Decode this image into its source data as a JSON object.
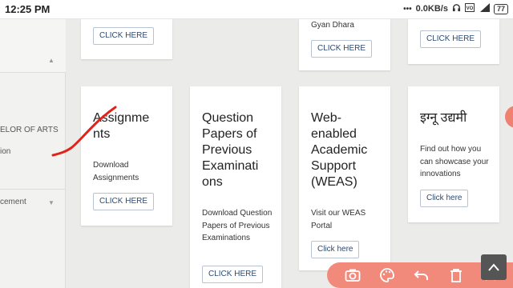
{
  "status_bar": {
    "time": "12:25 PM",
    "network_speed": "0.0KB/s",
    "battery": "77",
    "icons": [
      "dots-icon",
      "headphones-icon",
      "volte-icon",
      "signal-4g-icon",
      "battery-icon"
    ]
  },
  "sidebar": {
    "items": [
      {
        "label": "ELOR OF ARTS"
      },
      {
        "label": "ion"
      },
      {
        "label": "cement"
      }
    ]
  },
  "top_cards": [
    {
      "button": "CLICK HERE"
    },
    {
      "title": "Gyan Dhara",
      "button": "CLICK HERE"
    },
    {
      "button": "CLICK HERE"
    }
  ],
  "cards": [
    {
      "title": "Assignme nts",
      "desc": "Download Assignments",
      "button": "CLICK HERE"
    },
    {
      "title": "Question Papers of Previous Examinati ons",
      "desc": "Download Question Papers of Previous Examinations",
      "button": "CLICK HERE"
    },
    {
      "title": "Web- enabled Academic Support (WEAS)",
      "desc": "Visit our WEAS Portal",
      "button": "Click here"
    },
    {
      "title": "इग्नू उद्यमी",
      "desc": "Find out how you can showcase your innovations",
      "button": "Click here"
    }
  ],
  "colors": {
    "accent_toolbar": "#f18a7b",
    "button_text": "#2c4a73",
    "annotation_stroke": "#e0241b",
    "page_bg": "#ebebe9"
  },
  "toolbar": {
    "icons": [
      "camera-icon",
      "palette-icon",
      "undo-icon",
      "trash-icon",
      "close-icon"
    ]
  }
}
